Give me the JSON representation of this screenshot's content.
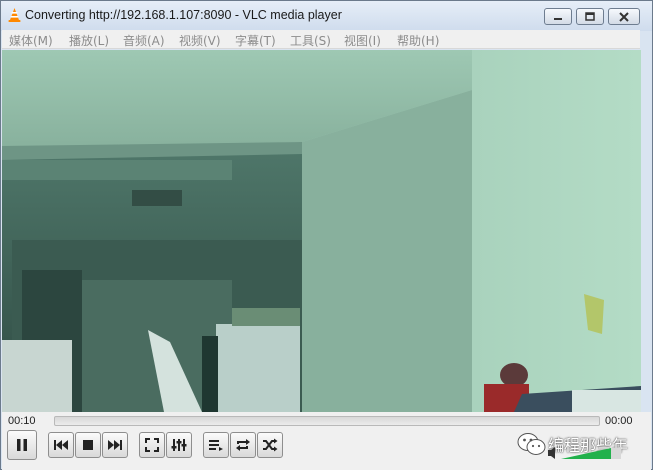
{
  "window": {
    "title": "Converting http://192.168.1.107:8090 - VLC media player"
  },
  "menu": [
    {
      "label": "媒体(M)"
    },
    {
      "label": "播放(L)"
    },
    {
      "label": "音频(A)"
    },
    {
      "label": "视频(V)"
    },
    {
      "label": "字幕(T)"
    },
    {
      "label": "工具(S)"
    },
    {
      "label": "视图(I)"
    },
    {
      "label": "帮助(H)"
    }
  ],
  "playback": {
    "elapsed": "00:10",
    "remaining": "00:00",
    "seek_progress": 0.0
  },
  "watermark": {
    "text": "编程那些年"
  },
  "icons": {
    "title": "vlc-cone-icon",
    "pause": "pause-icon",
    "previous": "previous-icon",
    "stop": "stop-icon",
    "next": "next-icon",
    "fullscreen": "fullscreen-icon",
    "extended": "extended-settings-icon",
    "playlist": "playlist-icon",
    "loop": "loop-icon",
    "shuffle": "shuffle-icon",
    "volume": "speaker-icon"
  },
  "colors": {
    "accent": "#ff8800",
    "volume": "#22b14c"
  }
}
